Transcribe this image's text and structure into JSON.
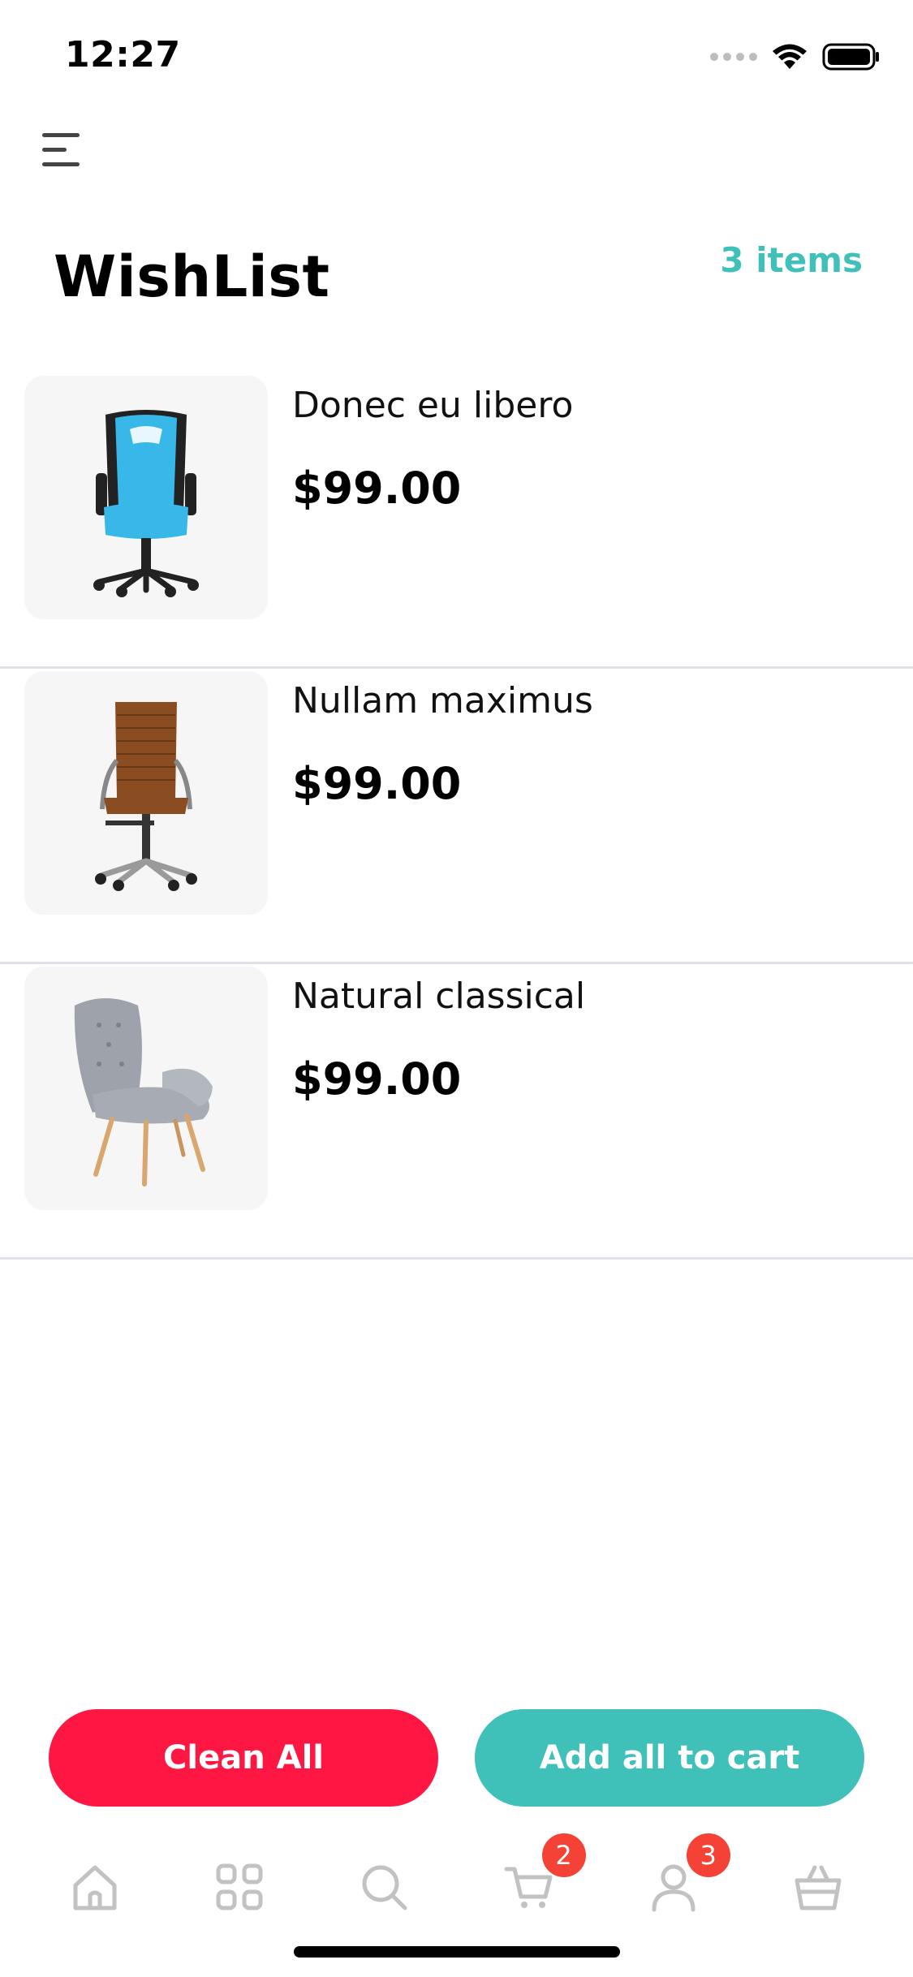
{
  "status_bar": {
    "time": "12:27"
  },
  "header": {
    "title": "WishList",
    "item_count": "3 items"
  },
  "items": [
    {
      "name": "Donec eu libero",
      "price": "$99.00",
      "image": "gaming-chair-blue"
    },
    {
      "name": "Nullam maximus",
      "price": "$99.00",
      "image": "office-chair-brown"
    },
    {
      "name": "Natural classical",
      "price": "$99.00",
      "image": "armchair-gray"
    }
  ],
  "actions": {
    "clean_all": "Clean All",
    "add_all_to_cart": "Add all to cart"
  },
  "tab_bar": {
    "tabs": [
      "home-icon",
      "grid-icon",
      "search-icon",
      "cart-icon",
      "user-icon",
      "basket-icon"
    ],
    "cart_badge": "2",
    "profile_badge": "3"
  },
  "colors": {
    "accent_teal": "#3fc1b9",
    "danger_red": "#ff1744",
    "badge_red": "#f44336",
    "icon_gray": "#c2c2c2"
  }
}
